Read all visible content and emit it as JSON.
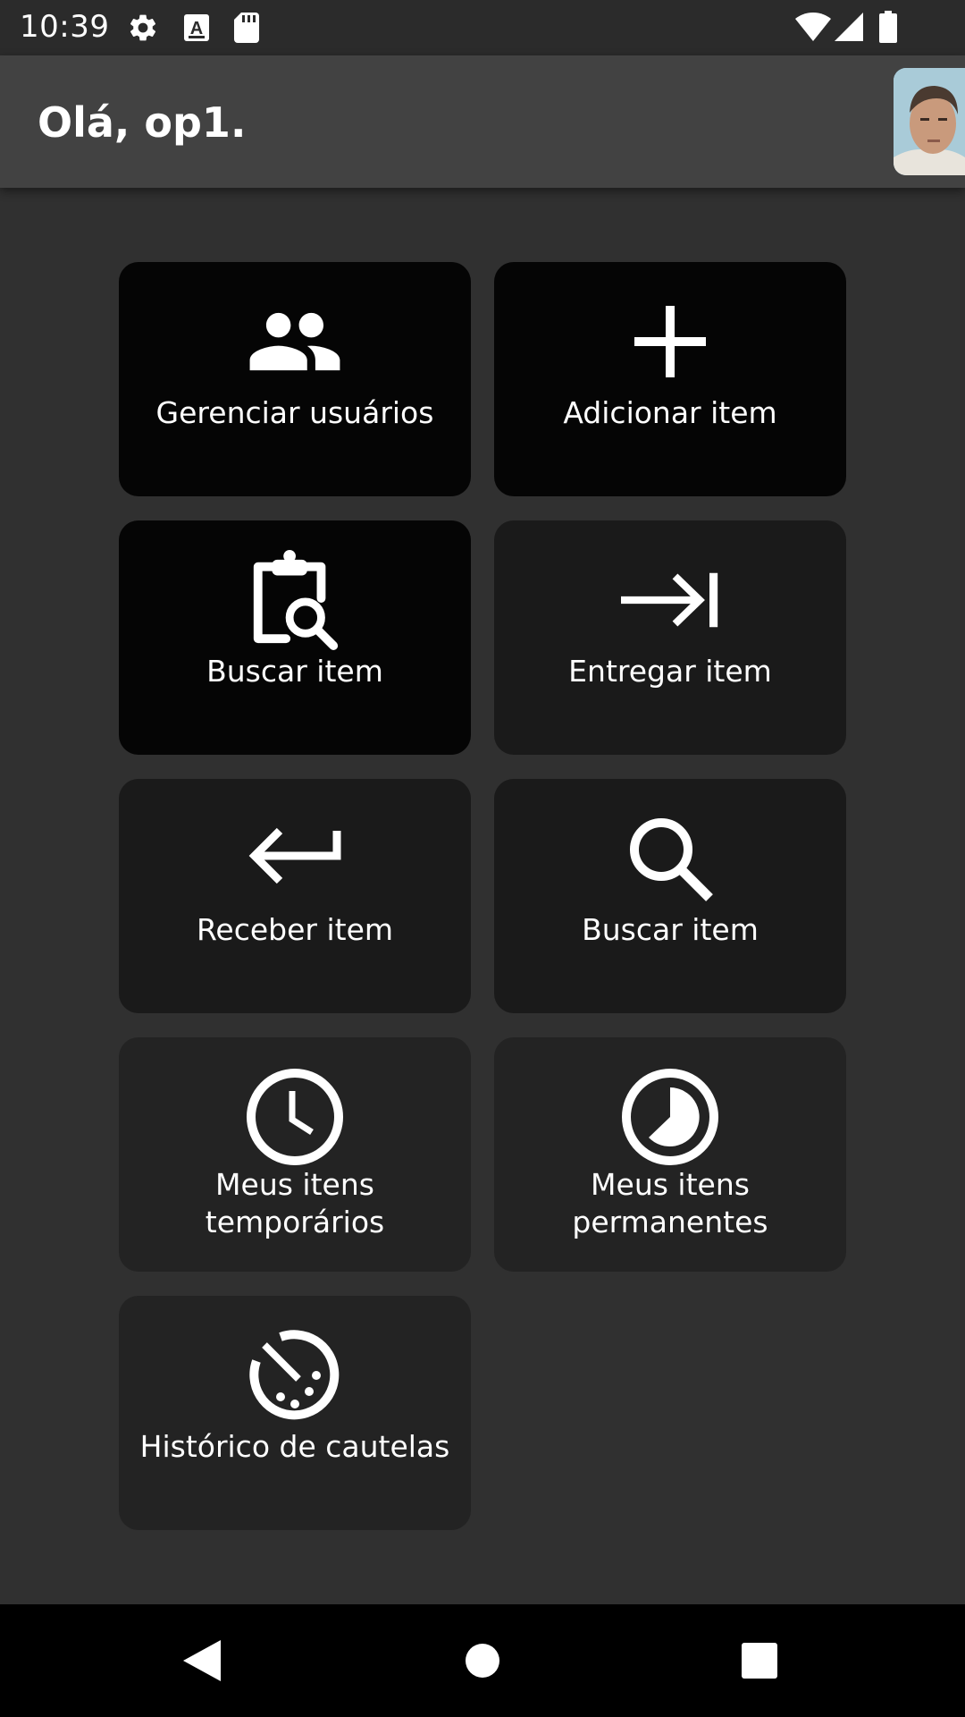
{
  "status_bar": {
    "time": "10:39",
    "left_icons": [
      "gear-icon",
      "font-icon",
      "sd-card-icon"
    ],
    "right_icons": [
      "wifi-icon",
      "signal-icon",
      "battery-icon"
    ]
  },
  "app_bar": {
    "greeting": "Olá, op1.",
    "avatar": "user-photo"
  },
  "tiles": [
    {
      "label": "Gerenciar usuários",
      "icon": "people-icon",
      "bg": "#050505"
    },
    {
      "label": "Adicionar item",
      "icon": "plus-icon",
      "bg": "#050505"
    },
    {
      "label": "Buscar item",
      "icon": "clipboard-search-icon",
      "bg": "#050505"
    },
    {
      "label": "Entregar item",
      "icon": "arrow-right-bar-icon",
      "bg": "#1a1a1a"
    },
    {
      "label": "Receber item",
      "icon": "return-arrow-icon",
      "bg": "#1a1a1a"
    },
    {
      "label": "Buscar item",
      "icon": "search-icon",
      "bg": "#1a1a1a"
    },
    {
      "label_line1": "Meus itens",
      "label_line2": "temporários",
      "icon": "clock-icon",
      "bg": "#232323"
    },
    {
      "label_line1": "Meus itens",
      "label_line2": "permanentes",
      "icon": "pie-clock-icon",
      "bg": "#232323"
    },
    {
      "label": "Histórico de cautelas",
      "icon": "timer-off-icon",
      "bg": "#232323"
    }
  ],
  "nav_bar": {
    "buttons": [
      "back-icon",
      "home-icon",
      "recents-icon"
    ]
  }
}
